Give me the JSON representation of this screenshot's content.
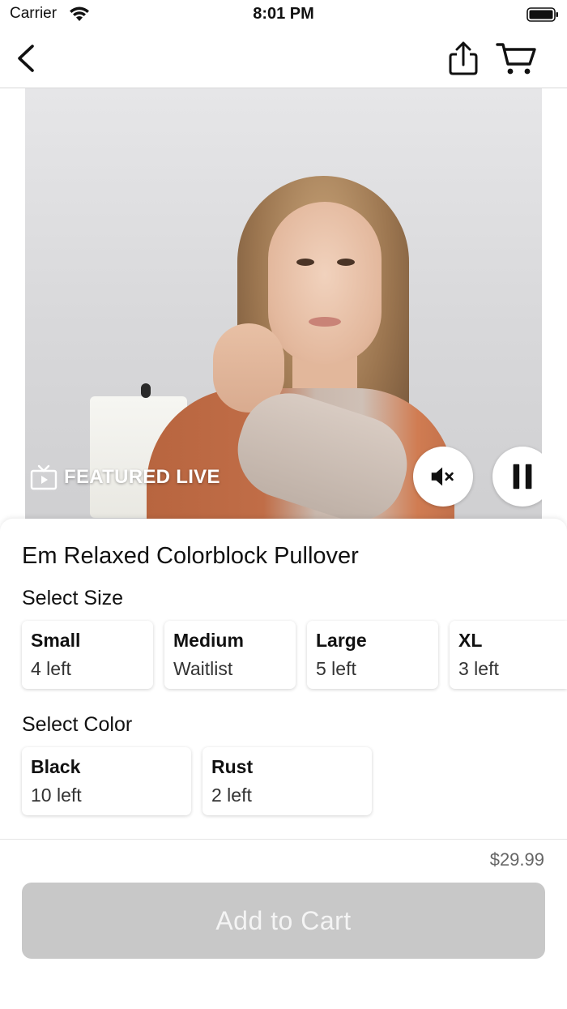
{
  "status_bar": {
    "carrier": "Carrier",
    "time": "8:01 PM"
  },
  "nav": {
    "back_icon": "chevron-left-icon",
    "share_icon": "share-icon",
    "cart_icon": "cart-icon"
  },
  "video": {
    "badge_label": "FEATURED LIVE",
    "badge_icon": "tv-icon",
    "mute_icon": "speaker-muted-icon",
    "pause_icon": "pause-icon"
  },
  "product": {
    "title": "Em Relaxed Colorblock Pullover",
    "size_heading": "Select Size",
    "sizes": [
      {
        "name": "Small",
        "stock": "4 left"
      },
      {
        "name": "Medium",
        "stock": "Waitlist"
      },
      {
        "name": "Large",
        "stock": "5 left"
      },
      {
        "name": "XL",
        "stock": "3 left"
      }
    ],
    "color_heading": "Select Color",
    "colors": [
      {
        "name": "Black",
        "stock": "10 left"
      },
      {
        "name": "Rust",
        "stock": "2 left"
      }
    ]
  },
  "footer": {
    "price": "$29.99",
    "add_to_cart_label": "Add to Cart"
  },
  "colors": {
    "button_disabled": "#c8c8c8",
    "text_primary": "#111111",
    "price_text": "#666666"
  }
}
